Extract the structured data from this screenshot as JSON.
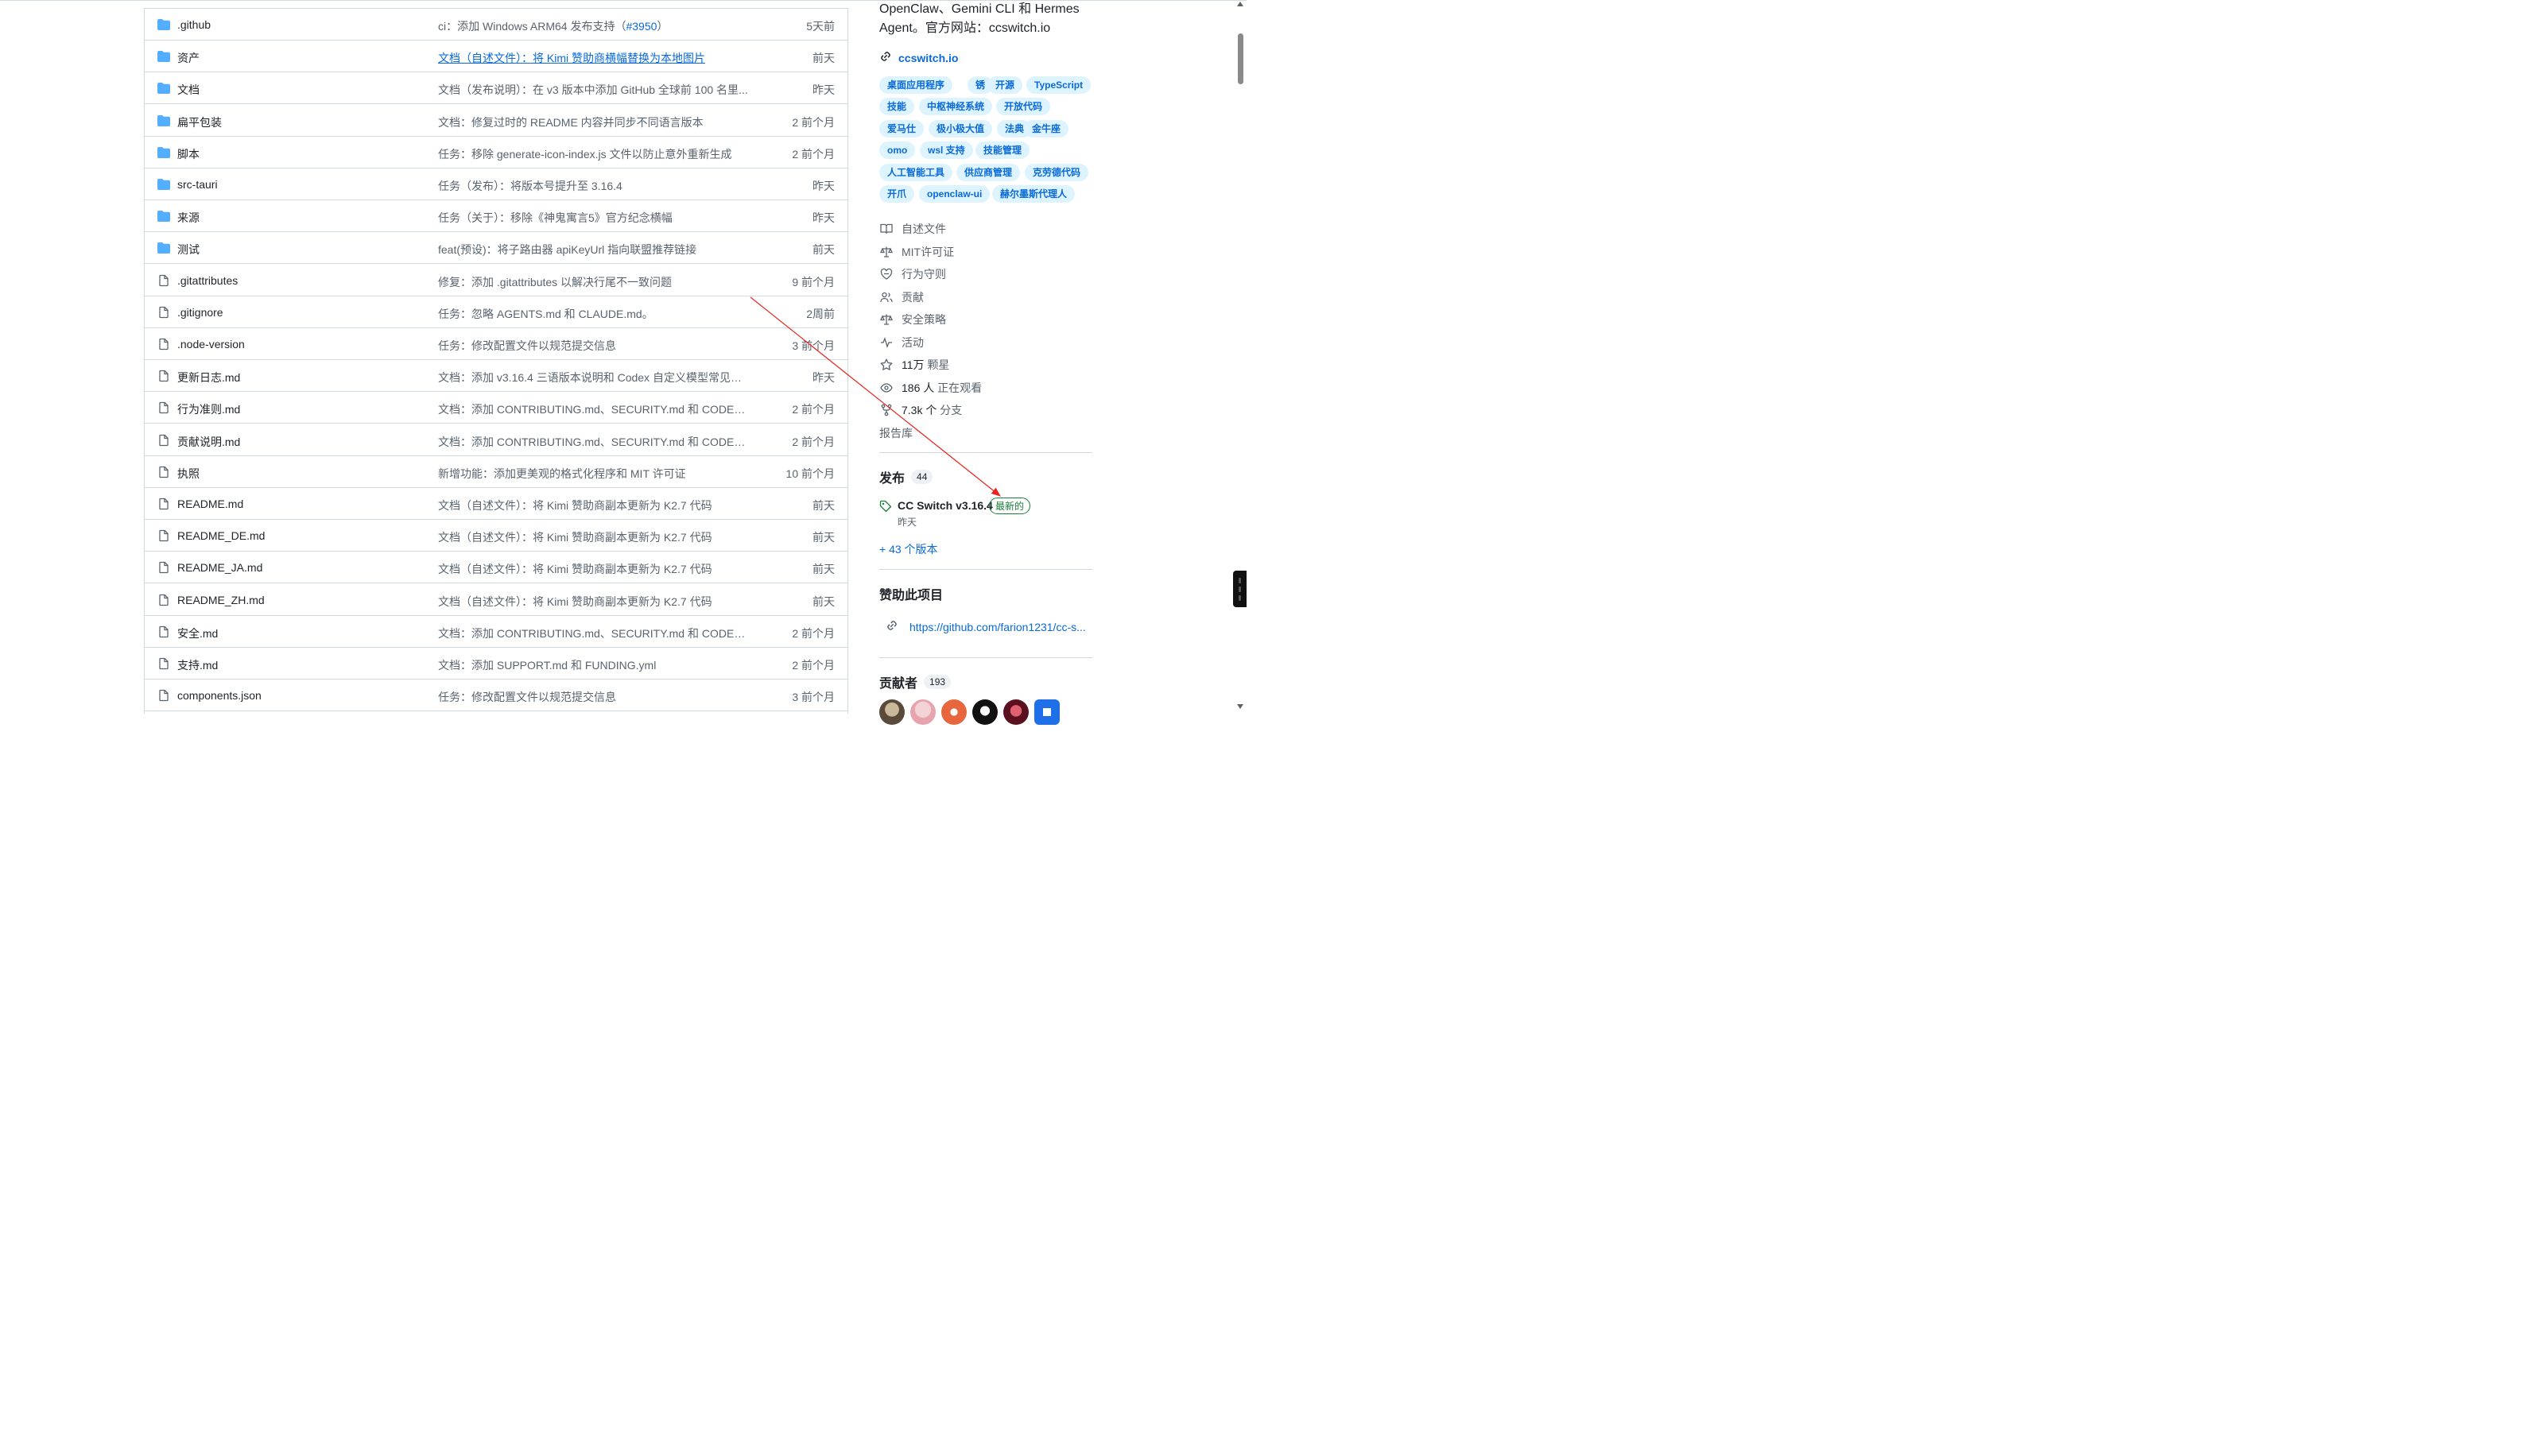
{
  "files": [
    {
      "name": ".github",
      "type": "dir",
      "message": "ci：添加 Windows ARM64 发布支持（",
      "pr": "#3950",
      "message_after": "）",
      "time": "5天前"
    },
    {
      "name": "资产",
      "type": "dir",
      "message": "文档（自述文件）：将 Kimi 赞助商横幅替换为本地图片",
      "link": true,
      "time": "前天"
    },
    {
      "name": "文档",
      "type": "dir",
      "message": "文档（发布说明）：在 v3 版本中添加 GitHub 全球前 100 名里...",
      "time": "昨天"
    },
    {
      "name": "扁平包装",
      "type": "dir",
      "message": "文档：修复过时的 README 内容并同步不同语言版本",
      "time": "2 前个月"
    },
    {
      "name": "脚本",
      "type": "dir",
      "message": "任务：移除 generate-icon-index.js 文件以防止意外重新生成",
      "time": "2 前个月"
    },
    {
      "name": "src-tauri",
      "type": "dir",
      "message": "任务（发布）：将版本号提升至 3.16.4",
      "time": "昨天"
    },
    {
      "name": "来源",
      "type": "dir",
      "message": "任务（关于）：移除《神鬼寓言5》官方纪念横幅",
      "time": "昨天"
    },
    {
      "name": "测试",
      "type": "dir",
      "message": "feat(预设)：将子路由器 apiKeyUrl 指向联盟推荐链接",
      "time": "前天"
    },
    {
      "name": ".gitattributes",
      "type": "file",
      "message": "修复：添加 .gitattributes 以解决行尾不一致问题",
      "time": "9 前个月"
    },
    {
      "name": ".gitignore",
      "type": "file",
      "message": "任务：忽略 AGENTS.md 和 CLAUDE.md。",
      "time": "2周前"
    },
    {
      "name": ".node-version",
      "type": "file",
      "message": "任务：修改配置文件以规范提交信息",
      "time": "3 前个月"
    },
    {
      "name": "更新日志.md",
      "type": "file",
      "message": "文档：添加 v3.16.4 三语版本说明和 Codex 自定义模型常见问...",
      "time": "昨天"
    },
    {
      "name": "行为准则.md",
      "type": "file",
      "message": "文档：添加 CONTRIBUTING.md、SECURITY.md 和 CODE_OF_...",
      "time": "2 前个月"
    },
    {
      "name": "贡献说明.md",
      "type": "file",
      "message": "文档：添加 CONTRIBUTING.md、SECURITY.md 和 CODE_OF_...",
      "time": "2 前个月"
    },
    {
      "name": "执照",
      "type": "file",
      "message": "新增功能：添加更美观的格式化程序和 MIT 许可证",
      "time": "10 前个月"
    },
    {
      "name": "README.md",
      "type": "file",
      "message": "文档（自述文件）：将 Kimi 赞助商副本更新为 K2.7 代码",
      "time": "前天"
    },
    {
      "name": "README_DE.md",
      "type": "file",
      "message": "文档（自述文件）：将 Kimi 赞助商副本更新为 K2.7 代码",
      "time": "前天"
    },
    {
      "name": "README_JA.md",
      "type": "file",
      "message": "文档（自述文件）：将 Kimi 赞助商副本更新为 K2.7 代码",
      "time": "前天"
    },
    {
      "name": "README_ZH.md",
      "type": "file",
      "message": "文档（自述文件）：将 Kimi 赞助商副本更新为 K2.7 代码",
      "time": "前天"
    },
    {
      "name": "安全.md",
      "type": "file",
      "message": "文档：添加 CONTRIBUTING.md、SECURITY.md 和 CODE_OF_...",
      "time": "2 前个月"
    },
    {
      "name": "支持.md",
      "type": "file",
      "message": "文档：添加 SUPPORT.md 和 FUNDING.yml",
      "time": "2 前个月"
    },
    {
      "name": "components.json",
      "type": "file",
      "message": "任务：修改配置文件以规范提交信息",
      "time": "3 前个月"
    }
  ],
  "sidebar": {
    "description_line1": "OpenClaw、Gemini CLI 和 Hermes",
    "description_line2": "Agent。官方网站：ccswitch.io",
    "homepage": "ccswitch.io",
    "topics": [
      [
        "桌面应用程序",
        "锈",
        "开源",
        "TypeScript"
      ],
      [
        "技能",
        "中枢神经系统",
        "开放代码"
      ],
      [
        "爱马仕",
        "极小极大值",
        "法典",
        "金牛座"
      ],
      [
        "omo",
        "wsl 支持",
        "技能管理"
      ],
      [
        "人工智能工具",
        "供应商管理",
        "克劳德代码"
      ],
      [
        "开爪",
        "openclaw-ui",
        "赫尔墨斯代理人"
      ]
    ],
    "meta": {
      "readme": "自述文件",
      "license": "MIT许可证",
      "conduct": "行为守则",
      "contribute": "贡献",
      "security": "安全策略",
      "activity": "活动",
      "stars_count": "11万",
      "stars_label": "颗星",
      "watchers_count": "186 人",
      "watchers_label": "正在观看",
      "forks_count": "7.3k 个",
      "forks_label": "分支"
    },
    "report": "报告库",
    "releases": {
      "title": "发布",
      "count": "44",
      "latest_name": "CC Switch v3.16.4",
      "latest_badge": "最新的",
      "latest_date": "昨天",
      "more": "+ 43 个版本"
    },
    "sponsor": {
      "title": "赞助此项目",
      "url": "https://github.com/farion1231/cc-s..."
    },
    "contributors": {
      "title": "贡献者",
      "count": "193"
    }
  },
  "colors": {
    "link": "#0969da",
    "topic_bg": "#ddf4ff",
    "folder": "#54aeff",
    "muted": "#59636e",
    "latest": "#1a7f37",
    "annotation_arrow": "#e8251f"
  }
}
